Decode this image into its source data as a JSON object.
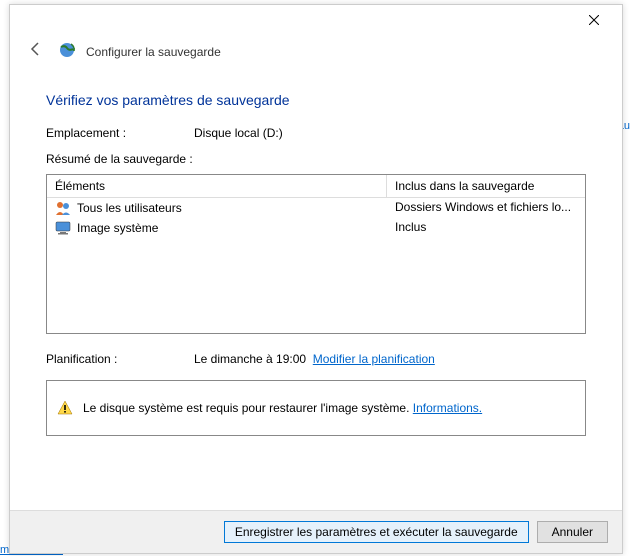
{
  "bg": {
    "au": "au",
    "maintenance": "maintenance"
  },
  "header": {
    "title": "Configurer la sauvegarde",
    "back_icon": "back-arrow",
    "app_icon": "globe-refresh-icon"
  },
  "page": {
    "heading": "Vérifiez vos paramètres de sauvegarde"
  },
  "location": {
    "label": "Emplacement :",
    "value": "Disque local (D:)"
  },
  "summary": {
    "label": "Résumé de la sauvegarde :",
    "columns": {
      "elements": "Éléments",
      "included": "Inclus dans la sauvegarde"
    },
    "rows": [
      {
        "icon": "users-icon",
        "label": "Tous les utilisateurs",
        "value": "Dossiers Windows et fichiers lo..."
      },
      {
        "icon": "monitor-icon",
        "label": "Image système",
        "value": "Inclus"
      }
    ]
  },
  "schedule": {
    "label": "Planification :",
    "value": "Le dimanche à 19:00",
    "change_link": "Modifier la planification"
  },
  "warning": {
    "text": "Le disque système est requis pour restaurer l'image système.",
    "link": "Informations."
  },
  "footer": {
    "primary": "Enregistrer les paramètres et exécuter la sauvegarde",
    "cancel": "Annuler"
  }
}
